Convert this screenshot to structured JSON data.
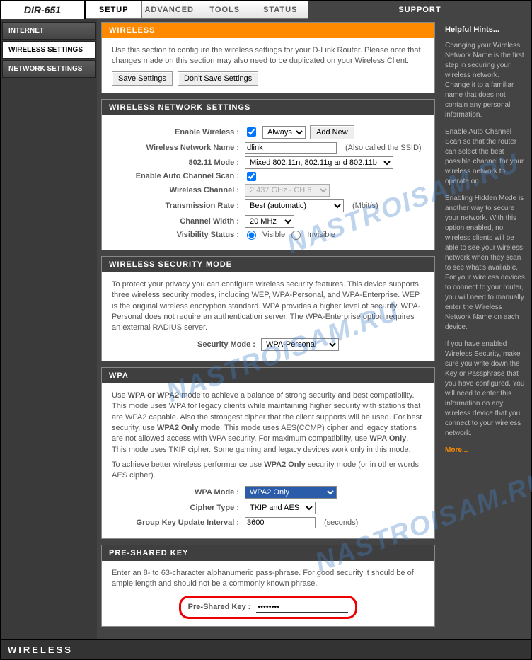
{
  "model": "DIR-651",
  "tabs": {
    "setup": "SETUP",
    "advanced": "ADVANCED",
    "tools": "TOOLS",
    "status": "STATUS",
    "support": "SUPPORT"
  },
  "sidebar": {
    "internet": "INTERNET",
    "wireless": "WIRELESS SETTINGS",
    "network": "NETWORK SETTINGS"
  },
  "wireless": {
    "title": "WIRELESS",
    "intro": "Use this section to configure the wireless settings for your D-Link Router. Please note that changes made on this section may also need to be duplicated on your Wireless Client.",
    "save": "Save Settings",
    "dont_save": "Don't Save Settings"
  },
  "wns": {
    "title": "WIRELESS NETWORK SETTINGS",
    "enable_label": "Enable Wireless :",
    "enable_checked": true,
    "schedule": "Always",
    "add_new": "Add New",
    "name_label": "Wireless Network Name :",
    "name_value": "dlink",
    "name_note": "(Also called the SSID)",
    "mode_label": "802.11 Mode :",
    "mode_value": "Mixed 802.11n, 802.11g and 802.11b",
    "auto_chan_label": "Enable Auto Channel Scan :",
    "auto_chan_checked": true,
    "chan_label": "Wireless Channel :",
    "chan_value": "2.437 GHz - CH 6",
    "rate_label": "Transmission Rate :",
    "rate_value": "Best (automatic)",
    "rate_unit": "(Mbit/s)",
    "width_label": "Channel Width :",
    "width_value": "20 MHz",
    "vis_label": "Visibility Status :",
    "vis_visible": "Visible",
    "vis_invisible": "Invisible"
  },
  "wsm": {
    "title": "WIRELESS SECURITY MODE",
    "desc": "To protect your privacy you can configure wireless security features. This device supports three wireless security modes, including WEP, WPA-Personal, and WPA-Enterprise. WEP is the original wireless encryption standard. WPA provides a higher level of security. WPA-Personal does not require an authentication server. The WPA-Enterprise option requires an external RADIUS server.",
    "mode_label": "Security Mode :",
    "mode_value": "WPA-Personal"
  },
  "wpa": {
    "title": "WPA",
    "desc1a": "Use ",
    "desc1b": "WPA or WPA2",
    "desc1c": " mode to achieve a balance of strong security and best compatibility. This mode uses WPA for legacy clients while maintaining higher security with stations that are WPA2 capable. Also the strongest cipher that the client supports will be used. For best security, use ",
    "desc1d": "WPA2 Only",
    "desc1e": " mode. This mode uses AES(CCMP) cipher and legacy stations are not allowed access with WPA security. For maximum compatibility, use ",
    "desc1f": "WPA Only",
    "desc1g": ". This mode uses TKIP cipher. Some gaming and legacy devices work only in this mode.",
    "desc2a": "To achieve better wireless performance use ",
    "desc2b": "WPA2 Only",
    "desc2c": " security mode (or in other words AES cipher).",
    "mode_label": "WPA Mode :",
    "mode_value": "WPA2 Only",
    "cipher_label": "Cipher Type :",
    "cipher_value": "TKIP and AES",
    "gkui_label": "Group Key Update Interval :",
    "gkui_value": "3600",
    "gkui_unit": "(seconds)"
  },
  "psk": {
    "title": "PRE-SHARED KEY",
    "desc": "Enter an 8- to 63-character alphanumeric pass-phrase. For good security it should be of ample length and should not be a commonly known phrase.",
    "label": "Pre-Shared Key :",
    "value": "••••••••"
  },
  "hints": {
    "title": "Helpful Hints...",
    "p1": "Changing your Wireless Network Name is the first step in securing your wireless network. Change it to a familiar name that does not contain any personal information.",
    "p2": "Enable Auto Channel Scan so that the router can select the best possible channel for your wireless network to operate on.",
    "p3": "Enabling Hidden Mode is another way to secure your network. With this option enabled, no wireless clients will be able to see your wireless network when they scan to see what's available. For your wireless devices to connect to your router, you will need to manually enter the Wireless Network Name on each device.",
    "p4": "If you have enabled Wireless Security, make sure you write down the Key or Passphrase that you have configured. You will need to enter this information on any wireless device that you connect to your wireless network.",
    "more": "More..."
  },
  "footer": "WIRELESS",
  "watermark": "NASTROISAM.RU"
}
